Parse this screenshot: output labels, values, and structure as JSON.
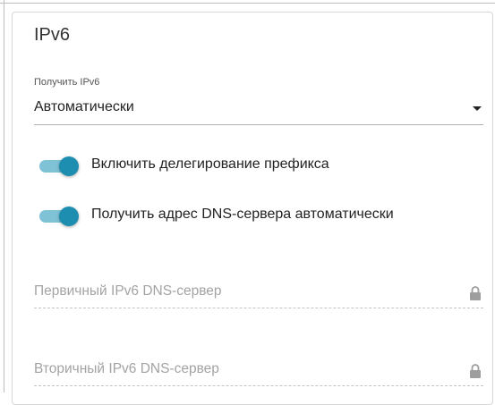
{
  "section": {
    "title": "IPv6"
  },
  "obtain_ipv6": {
    "label": "Получить IPv6",
    "value": "Автоматически"
  },
  "toggles": [
    {
      "label": "Включить делегирование префикса",
      "on": true
    },
    {
      "label": "Получить адрес DNS-сервера автоматически",
      "on": true
    }
  ],
  "fields": {
    "primary_dns": {
      "placeholder": "Первичный IPv6 DNS-сервер",
      "locked": true
    },
    "secondary_dns": {
      "placeholder": "Вторичный IPv6 DNS-сервер",
      "locked": true
    }
  },
  "icons": {
    "select_caret": "chevron-down-icon",
    "field_lock": "lock-icon"
  },
  "colors": {
    "toggle_on": "#1d8db0",
    "toggle_track_on": "#7fc2d6"
  }
}
